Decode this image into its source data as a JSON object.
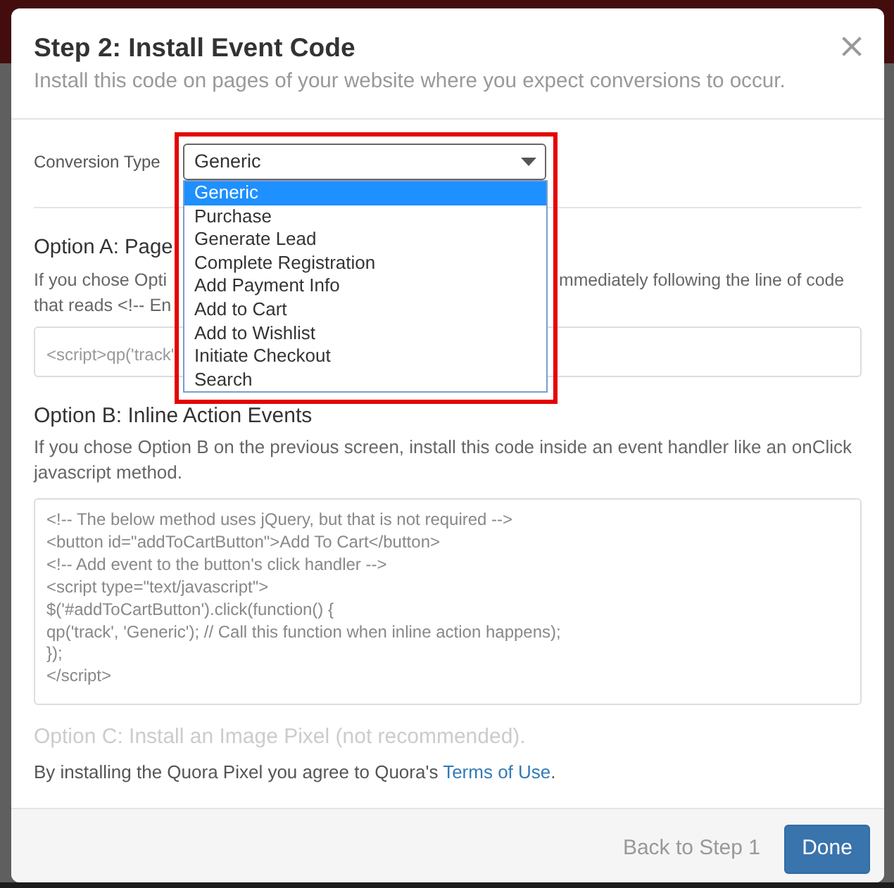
{
  "dialog": {
    "title": "Step 2: Install Event Code",
    "subtitle": "Install this code on pages of your website where you expect conversions to occur."
  },
  "conversion_type": {
    "label": "Conversion Type",
    "value": "Generic",
    "expanded": true,
    "highlighted": true,
    "options": [
      {
        "label": "Generic",
        "selected": true
      },
      {
        "label": "Purchase",
        "selected": false
      },
      {
        "label": "Generate Lead",
        "selected": false
      },
      {
        "label": "Complete Registration",
        "selected": false
      },
      {
        "label": "Add Payment Info",
        "selected": false
      },
      {
        "label": "Add to Cart",
        "selected": false
      },
      {
        "label": "Add to Wishlist",
        "selected": false
      },
      {
        "label": "Initiate Checkout",
        "selected": false
      },
      {
        "label": "Search",
        "selected": false
      }
    ]
  },
  "option_a": {
    "title": "Option A: Page",
    "description_lines": [
      {
        "before_menu": "If you chose Opti",
        "after_menu": "mmediately following the line of code"
      },
      {
        "before_menu": "that reads <!-- En"
      }
    ],
    "code": "<script>qp('track'"
  },
  "option_b": {
    "title": "Option B: Inline Action Events",
    "description": "If you chose Option B on the previous screen, install this code inside an event handler like an onClick javascript method.",
    "code_lines": [
      "<!-- The below method uses jQuery, but that is not required -->",
      "<button id=\"addToCartButton\">Add To Cart</button>",
      "<!-- Add event to the button's click handler -->",
      "<script type=\"text/javascript\">",
      "$('#addToCartButton').click(function() {",
      "qp('track', 'Generic'); // Call this function when inline action happens);",
      "});",
      "</script>"
    ]
  },
  "option_c": {
    "title": "Option C: Install an Image Pixel (not recommended).",
    "disabled": true
  },
  "terms": {
    "text": "By installing the Quora Pixel you agree to Quora's ",
    "link": "Terms of Use",
    "after": "."
  },
  "footer": {
    "back": "Back to Step 1",
    "done": "Done"
  }
}
